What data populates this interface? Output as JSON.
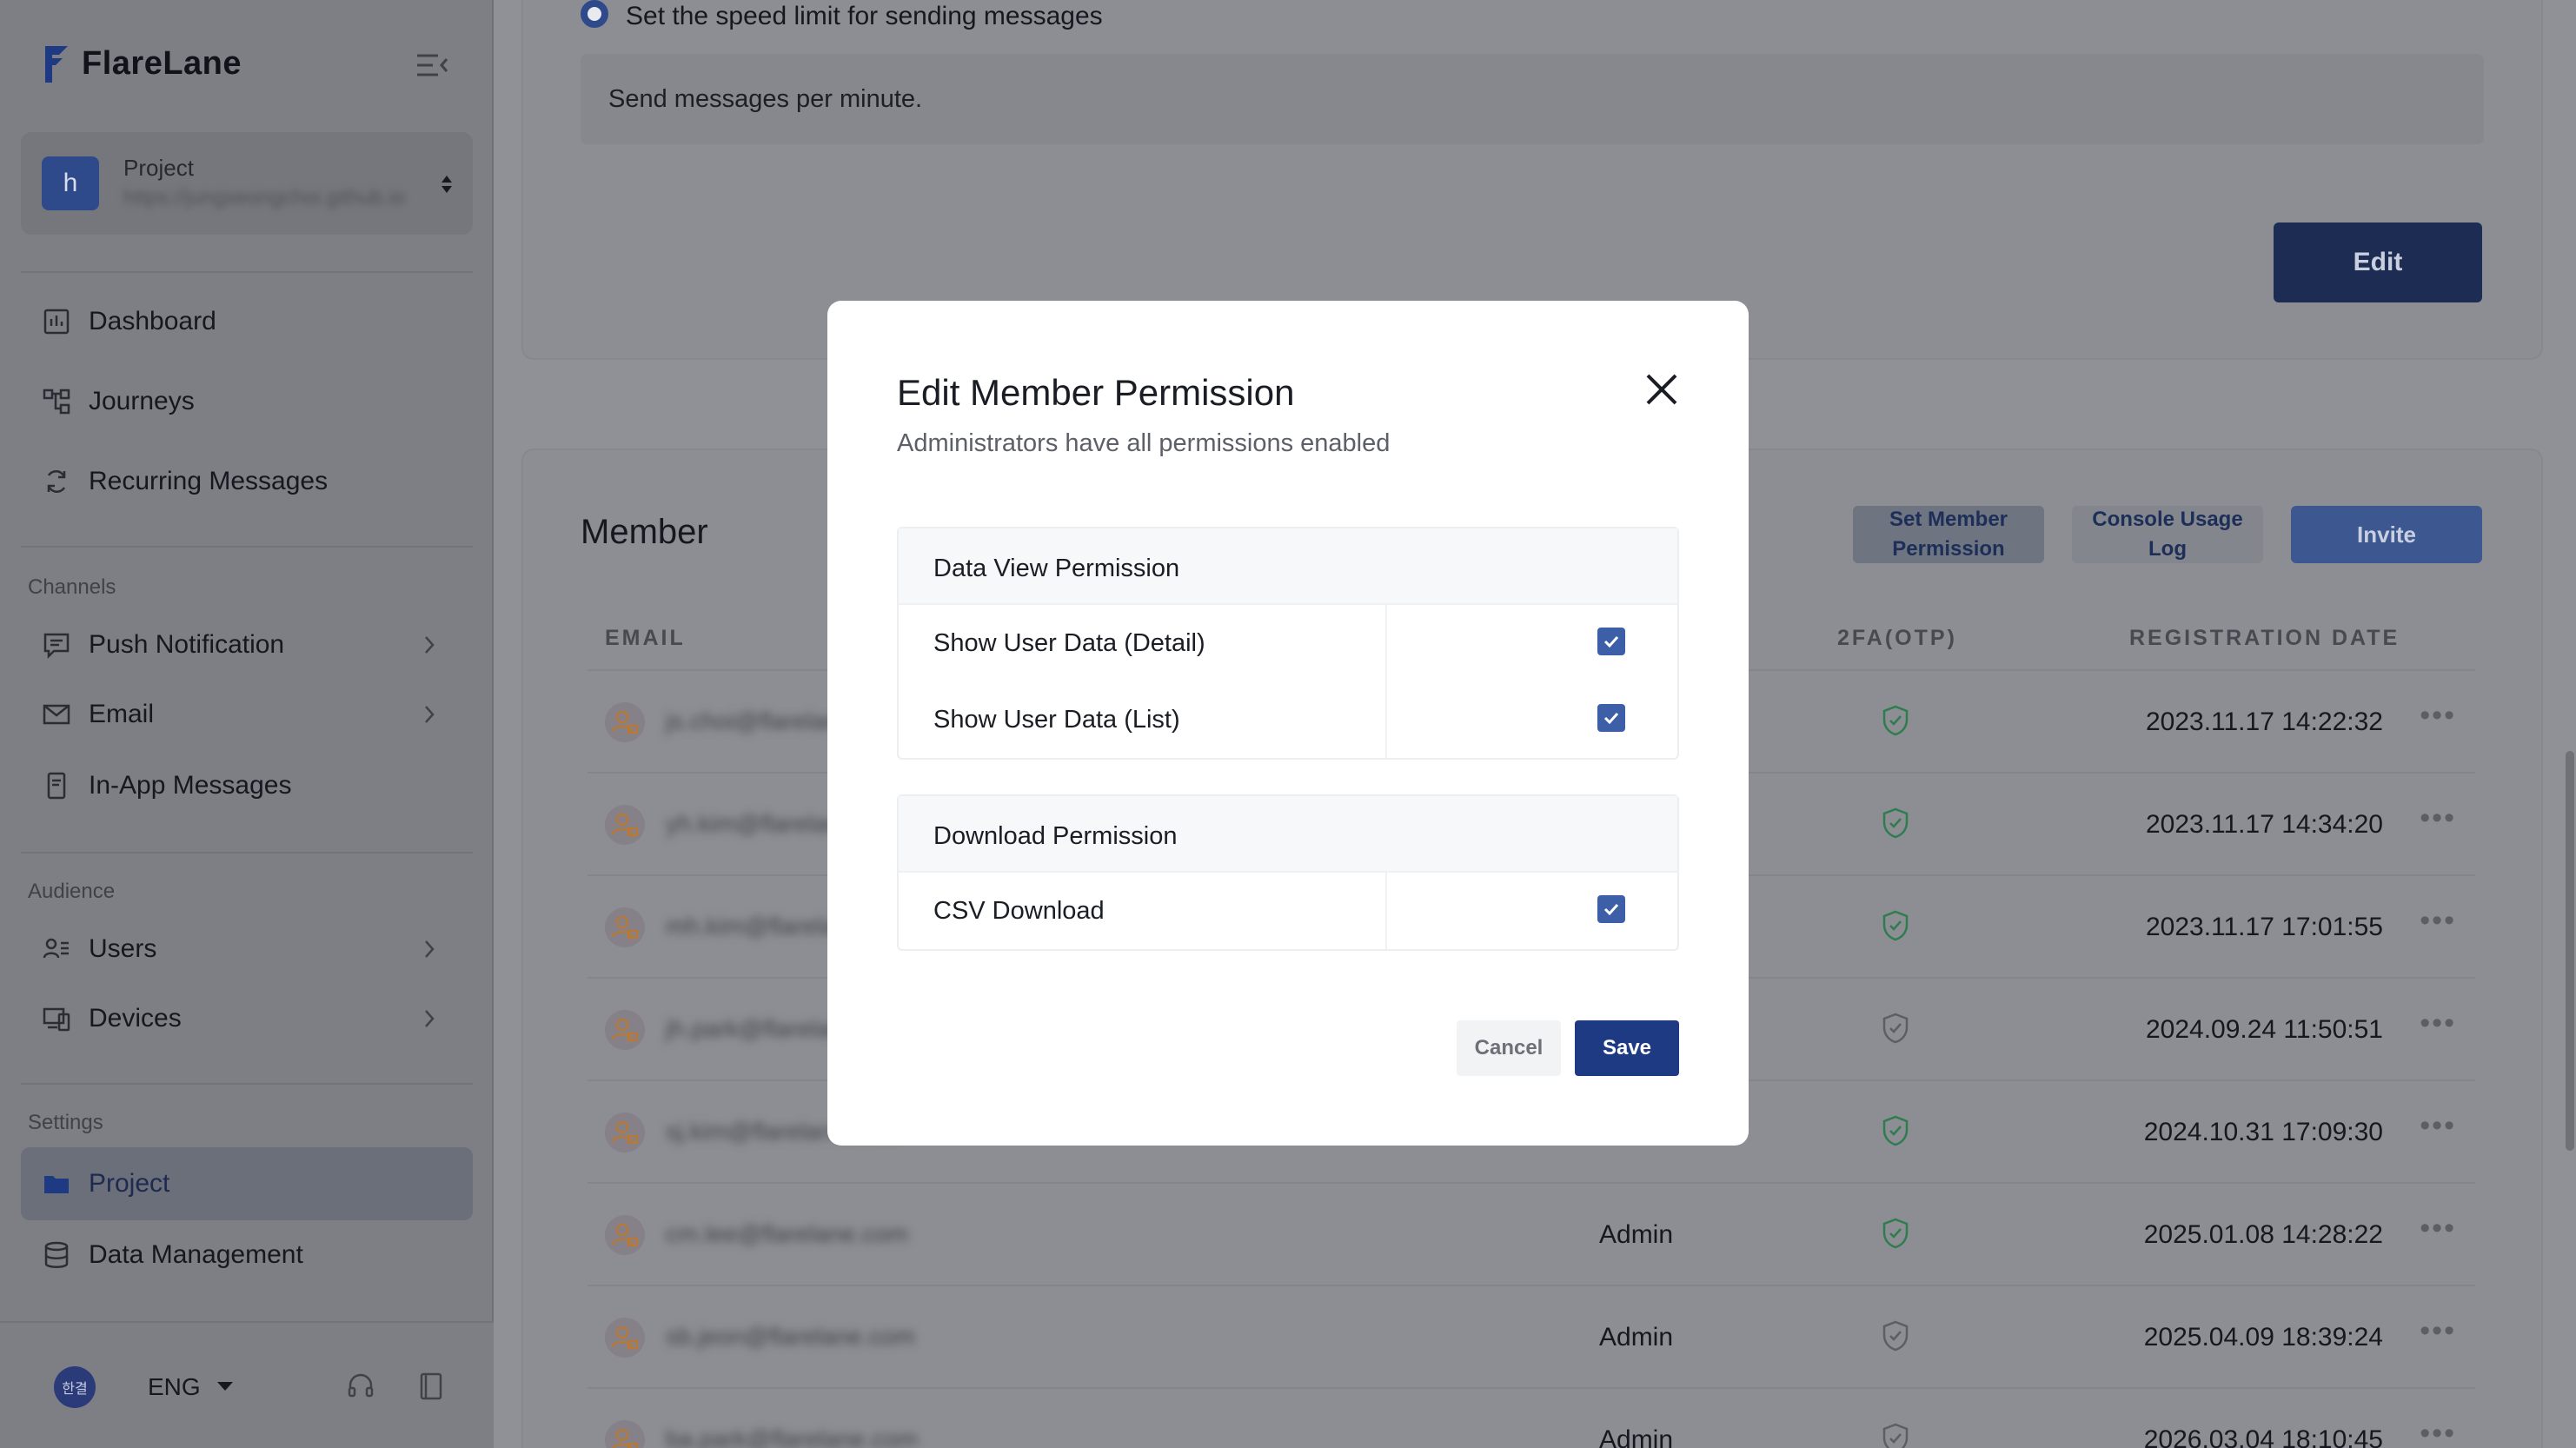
{
  "brand": {
    "name": "FlareLane"
  },
  "project": {
    "label": "Project",
    "avatar_letter": "h",
    "url": "https://jungseongchoi.github.io"
  },
  "nav": {
    "dashboard": "Dashboard",
    "journeys": "Journeys",
    "recurring": "Recurring Messages",
    "channels_label": "Channels",
    "push": "Push Notification",
    "email": "Email",
    "inapp": "In-App Messages",
    "audience_label": "Audience",
    "users": "Users",
    "devices": "Devices",
    "settings_label": "Settings",
    "project": "Project",
    "data_management": "Data Management"
  },
  "footer": {
    "flag": "한결",
    "language": "ENG"
  },
  "speed": {
    "label": "Set the speed limit for sending messages",
    "input_text": "Send messages per minute.",
    "edit_label": "Edit"
  },
  "member": {
    "title": "Member",
    "set_permission": "Set Member Permission",
    "console_log": "Console Usage Log",
    "invite": "Invite",
    "headers": {
      "email": "EMAIL",
      "otp": "2FA(OTP)",
      "date": "REGISTRATION DATE"
    },
    "rows": [
      {
        "email": "js.choi@flarelane.com",
        "role": "",
        "otp": true,
        "date": "2023.11.17 14:22:32"
      },
      {
        "email": "yh.kim@flarelane.com",
        "role": "",
        "otp": true,
        "date": "2023.11.17 14:34:20"
      },
      {
        "email": "mh.kim@flarelane.com",
        "role": "",
        "otp": true,
        "date": "2023.11.17 17:01:55"
      },
      {
        "email": "jh.park@flarelane.com",
        "role": "",
        "otp": false,
        "date": "2024.09.24 11:50:51"
      },
      {
        "email": "sj.kim@flarelane.com",
        "role": "",
        "otp": true,
        "date": "2024.10.31 17:09:30"
      },
      {
        "email": "cm.lee@flarelane.com",
        "role": "Admin",
        "otp": true,
        "date": "2025.01.08 14:28:22"
      },
      {
        "email": "sb.jeon@flarelane.com",
        "role": "Admin",
        "otp": false,
        "date": "2025.04.09 18:39:24"
      },
      {
        "email": "ba.park@flarelane.com",
        "role": "Admin",
        "otp": false,
        "date": "2026.03.04 18:10:45"
      }
    ]
  },
  "modal": {
    "title": "Edit Member Permission",
    "subtitle": "Administrators have all permissions enabled",
    "data_view_title": "Data View Permission",
    "show_detail": "Show User Data (Detail)",
    "show_list": "Show User Data (List)",
    "download_title": "Download Permission",
    "csv": "CSV Download",
    "cancel": "Cancel",
    "save": "Save"
  },
  "colors": {
    "primary": "#1e3a82",
    "checkbox": "#3d5fa8",
    "otp_on": "#2e7d4f",
    "otp_off": "#5b5e64"
  }
}
